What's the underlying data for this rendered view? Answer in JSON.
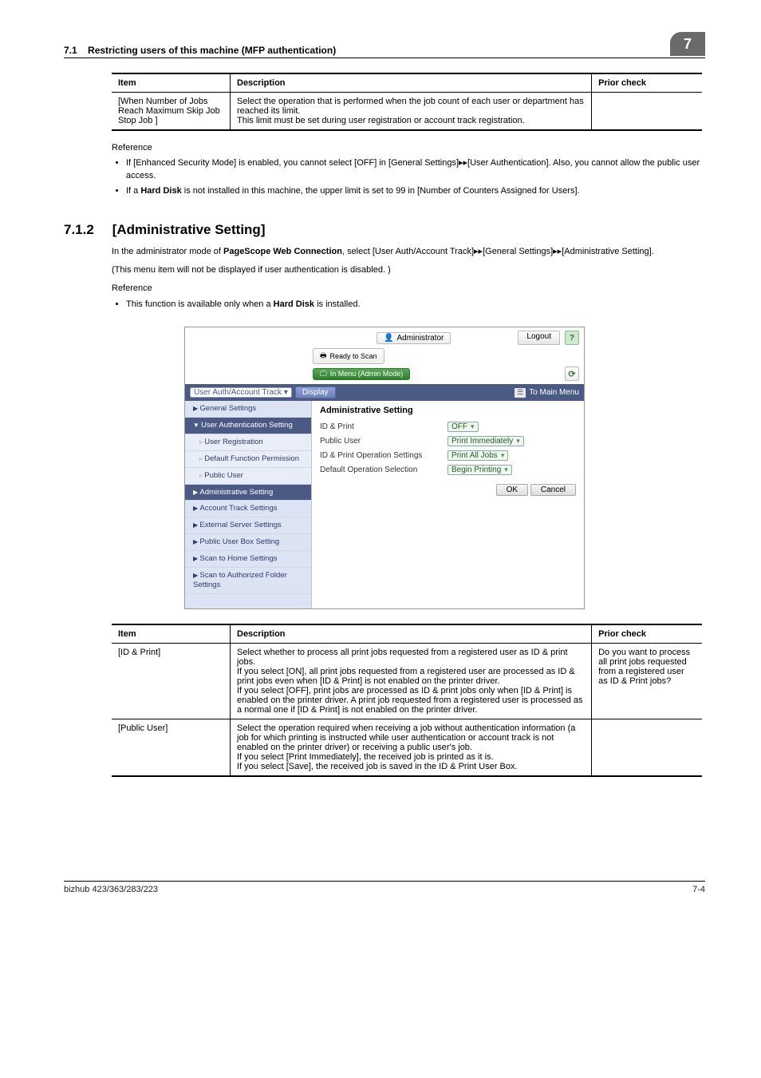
{
  "header": {
    "section_no": "7.1",
    "section_title": "Restricting users of this machine (MFP authentication)",
    "page_badge": "7"
  },
  "table1": {
    "cols": {
      "item": "Item",
      "desc": "Description",
      "prior": "Prior check"
    },
    "rows": [
      {
        "item": "[When Number of Jobs Reach Maximum Skip Job Stop Job ]",
        "desc": "Select the operation that is performed when the job count of each user or department has reached its limit.\nThis limit must be set during user registration or account track registration.",
        "prior": ""
      }
    ]
  },
  "ref1": {
    "label": "Reference",
    "items": [
      "If [Enhanced Security Mode] is enabled, you cannot select [OFF] in [General Settings]▸▸[User Authentication]. Also, you cannot allow the public user access.",
      "If a Hard Disk is not installed in this machine, the upper limit is set to 99 in [Number of Counters Assigned for Users]."
    ]
  },
  "section": {
    "num": "7.1.2",
    "title": "[Administrative Setting]",
    "para1": "In the administrator mode of PageScope Web Connection, select [User Auth/Account Track]▸▸[General Settings]▸▸[Administrative Setting].",
    "para2": "(This menu item will not be displayed if user authentication is disabled. )",
    "ref_label": "Reference",
    "ref_items": [
      "This function is available only when a Hard Disk is installed."
    ]
  },
  "screenshot": {
    "admin_label": "Administrator",
    "logout": "Logout",
    "ready": "Ready to Scan",
    "menu_mode": "In Menu (Admin Mode)",
    "select": "User Auth/Account Track",
    "display": "Display",
    "main_menu": "To Main Menu",
    "sidebar": [
      {
        "label": "General Settings",
        "cls": "header"
      },
      {
        "label": "User Authentication Setting",
        "cls": "open selected"
      },
      {
        "label": "User Registration",
        "cls": "sb-sub"
      },
      {
        "label": "Default Function Permission",
        "cls": "sb-sub"
      },
      {
        "label": "Public User",
        "cls": "sb-sub"
      },
      {
        "label": "Administrative Setting",
        "cls": "header selected"
      },
      {
        "label": "Account Track Settings",
        "cls": "header"
      },
      {
        "label": "External Server Settings",
        "cls": "header"
      },
      {
        "label": "Public User Box Setting",
        "cls": "header"
      },
      {
        "label": "Scan to Home Settings",
        "cls": "header"
      },
      {
        "label": "Scan to Authorized Folder Settings",
        "cls": "header"
      }
    ],
    "content_title": "Administrative Setting",
    "rows": [
      {
        "lbl": "ID & Print",
        "val": "OFF"
      },
      {
        "lbl": "Public User",
        "val": "Print Immediately"
      },
      {
        "lbl": "ID & Print Operation Settings",
        "val": "Print All Jobs"
      },
      {
        "lbl": "Default Operation Selection",
        "val": "Begin Printing"
      }
    ],
    "ok": "OK",
    "cancel": "Cancel"
  },
  "table2": {
    "cols": {
      "item": "Item",
      "desc": "Description",
      "prior": "Prior check"
    },
    "rows": [
      {
        "item": "[ID & Print]",
        "desc": "Select whether to process all print jobs requested from a registered user as ID & print jobs.\nIf you select [ON], all print jobs requested from a registered user are processed as ID & print jobs even when [ID & Print] is not enabled on the printer driver.\nIf you select [OFF], print jobs are processed as ID & print jobs only when [ID & Print] is enabled on the printer driver. A print job requested from a registered user is processed as a normal one if [ID & Print] is not enabled on the printer driver.",
        "prior": "Do you want to process all print jobs requested from a registered user as ID & Print jobs?"
      },
      {
        "item": "[Public User]",
        "desc": "Select the operation required when receiving a job without authentication information (a job for which printing is instructed while user authentication or account track is not enabled on the printer driver) or receiving a public user's job.\nIf you select [Print Immediately], the received job is printed as it is.\nIf you select [Save], the received job is saved in the ID & Print User Box.",
        "prior": ""
      }
    ]
  },
  "footer": {
    "left": "bizhub 423/363/283/223",
    "right": "7-4"
  }
}
